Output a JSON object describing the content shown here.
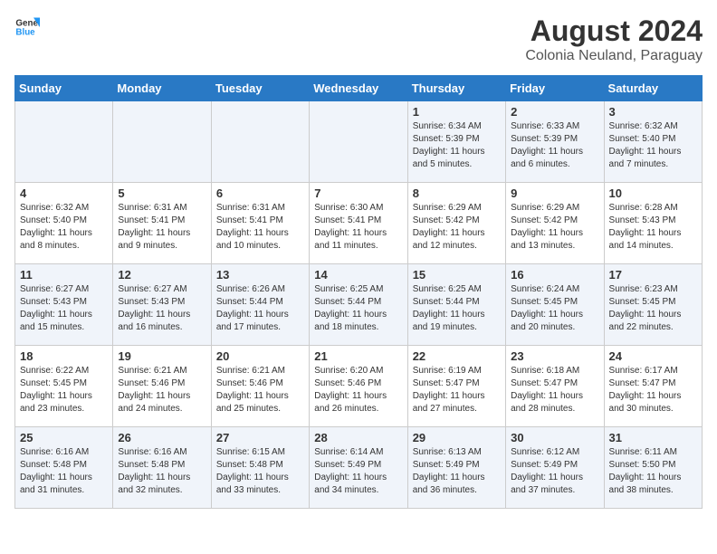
{
  "header": {
    "logo_general": "General",
    "logo_blue": "Blue",
    "month_year": "August 2024",
    "location": "Colonia Neuland, Paraguay"
  },
  "days_of_week": [
    "Sunday",
    "Monday",
    "Tuesday",
    "Wednesday",
    "Thursday",
    "Friday",
    "Saturday"
  ],
  "weeks": [
    [
      {
        "day": "",
        "info": ""
      },
      {
        "day": "",
        "info": ""
      },
      {
        "day": "",
        "info": ""
      },
      {
        "day": "",
        "info": ""
      },
      {
        "day": "1",
        "info": "Sunrise: 6:34 AM\nSunset: 5:39 PM\nDaylight: 11 hours and 5 minutes."
      },
      {
        "day": "2",
        "info": "Sunrise: 6:33 AM\nSunset: 5:39 PM\nDaylight: 11 hours and 6 minutes."
      },
      {
        "day": "3",
        "info": "Sunrise: 6:32 AM\nSunset: 5:40 PM\nDaylight: 11 hours and 7 minutes."
      }
    ],
    [
      {
        "day": "4",
        "info": "Sunrise: 6:32 AM\nSunset: 5:40 PM\nDaylight: 11 hours and 8 minutes."
      },
      {
        "day": "5",
        "info": "Sunrise: 6:31 AM\nSunset: 5:41 PM\nDaylight: 11 hours and 9 minutes."
      },
      {
        "day": "6",
        "info": "Sunrise: 6:31 AM\nSunset: 5:41 PM\nDaylight: 11 hours and 10 minutes."
      },
      {
        "day": "7",
        "info": "Sunrise: 6:30 AM\nSunset: 5:41 PM\nDaylight: 11 hours and 11 minutes."
      },
      {
        "day": "8",
        "info": "Sunrise: 6:29 AM\nSunset: 5:42 PM\nDaylight: 11 hours and 12 minutes."
      },
      {
        "day": "9",
        "info": "Sunrise: 6:29 AM\nSunset: 5:42 PM\nDaylight: 11 hours and 13 minutes."
      },
      {
        "day": "10",
        "info": "Sunrise: 6:28 AM\nSunset: 5:43 PM\nDaylight: 11 hours and 14 minutes."
      }
    ],
    [
      {
        "day": "11",
        "info": "Sunrise: 6:27 AM\nSunset: 5:43 PM\nDaylight: 11 hours and 15 minutes."
      },
      {
        "day": "12",
        "info": "Sunrise: 6:27 AM\nSunset: 5:43 PM\nDaylight: 11 hours and 16 minutes."
      },
      {
        "day": "13",
        "info": "Sunrise: 6:26 AM\nSunset: 5:44 PM\nDaylight: 11 hours and 17 minutes."
      },
      {
        "day": "14",
        "info": "Sunrise: 6:25 AM\nSunset: 5:44 PM\nDaylight: 11 hours and 18 minutes."
      },
      {
        "day": "15",
        "info": "Sunrise: 6:25 AM\nSunset: 5:44 PM\nDaylight: 11 hours and 19 minutes."
      },
      {
        "day": "16",
        "info": "Sunrise: 6:24 AM\nSunset: 5:45 PM\nDaylight: 11 hours and 20 minutes."
      },
      {
        "day": "17",
        "info": "Sunrise: 6:23 AM\nSunset: 5:45 PM\nDaylight: 11 hours and 22 minutes."
      }
    ],
    [
      {
        "day": "18",
        "info": "Sunrise: 6:22 AM\nSunset: 5:45 PM\nDaylight: 11 hours and 23 minutes."
      },
      {
        "day": "19",
        "info": "Sunrise: 6:21 AM\nSunset: 5:46 PM\nDaylight: 11 hours and 24 minutes."
      },
      {
        "day": "20",
        "info": "Sunrise: 6:21 AM\nSunset: 5:46 PM\nDaylight: 11 hours and 25 minutes."
      },
      {
        "day": "21",
        "info": "Sunrise: 6:20 AM\nSunset: 5:46 PM\nDaylight: 11 hours and 26 minutes."
      },
      {
        "day": "22",
        "info": "Sunrise: 6:19 AM\nSunset: 5:47 PM\nDaylight: 11 hours and 27 minutes."
      },
      {
        "day": "23",
        "info": "Sunrise: 6:18 AM\nSunset: 5:47 PM\nDaylight: 11 hours and 28 minutes."
      },
      {
        "day": "24",
        "info": "Sunrise: 6:17 AM\nSunset: 5:47 PM\nDaylight: 11 hours and 30 minutes."
      }
    ],
    [
      {
        "day": "25",
        "info": "Sunrise: 6:16 AM\nSunset: 5:48 PM\nDaylight: 11 hours and 31 minutes."
      },
      {
        "day": "26",
        "info": "Sunrise: 6:16 AM\nSunset: 5:48 PM\nDaylight: 11 hours and 32 minutes."
      },
      {
        "day": "27",
        "info": "Sunrise: 6:15 AM\nSunset: 5:48 PM\nDaylight: 11 hours and 33 minutes."
      },
      {
        "day": "28",
        "info": "Sunrise: 6:14 AM\nSunset: 5:49 PM\nDaylight: 11 hours and 34 minutes."
      },
      {
        "day": "29",
        "info": "Sunrise: 6:13 AM\nSunset: 5:49 PM\nDaylight: 11 hours and 36 minutes."
      },
      {
        "day": "30",
        "info": "Sunrise: 6:12 AM\nSunset: 5:49 PM\nDaylight: 11 hours and 37 minutes."
      },
      {
        "day": "31",
        "info": "Sunrise: 6:11 AM\nSunset: 5:50 PM\nDaylight: 11 hours and 38 minutes."
      }
    ]
  ]
}
